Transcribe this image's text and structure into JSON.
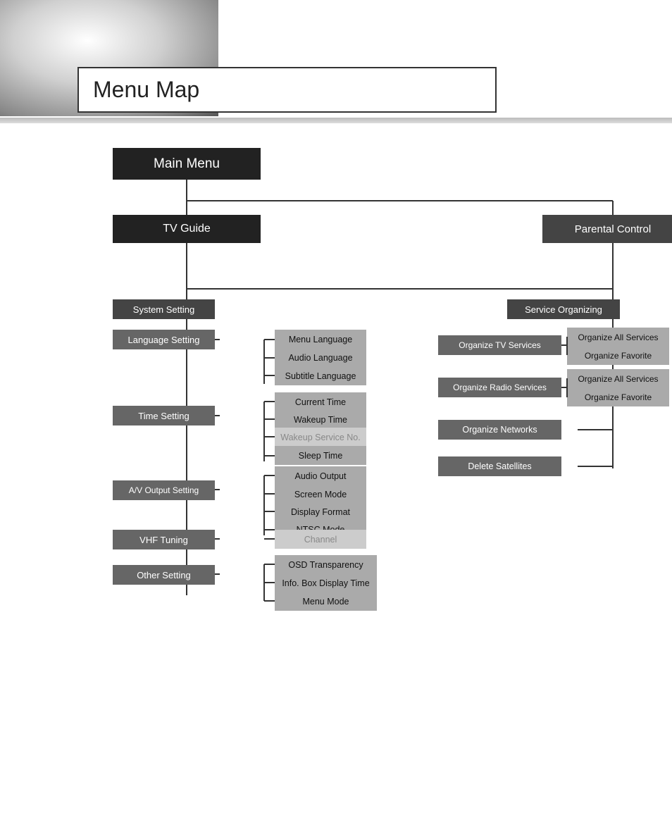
{
  "page": {
    "title": "Menu Map"
  },
  "main_menu": {
    "label": "Main Menu"
  },
  "level1": {
    "tvguide": "TV Guide",
    "parental": "Parental Control"
  },
  "left_tree": {
    "system_setting": "System Setting",
    "language_setting": {
      "label": "Language Setting",
      "children": [
        "Menu Language",
        "Audio Language",
        "Subtitle Language"
      ]
    },
    "time_setting": {
      "label": "Time Setting",
      "children": [
        "Current Time",
        "Wakeup Time",
        "Wakeup Service No.",
        "Sleep Time"
      ]
    },
    "av_output": {
      "label": "A/V Output Setting",
      "children": [
        "Audio Output",
        "Screen Mode",
        "Display Format",
        "NTSC Mode"
      ]
    },
    "vhf_tuning": {
      "label": "VHF Tuning",
      "children": [
        "Channel"
      ]
    },
    "other_setting": {
      "label": "Other Setting",
      "children": [
        "OSD Transparency",
        "Info. Box Display Time",
        "Menu Mode"
      ]
    }
  },
  "right_tree": {
    "service_organizing": "Service Organizing",
    "organize_tv": {
      "label": "Organize TV Services",
      "children": [
        "Organize All Services",
        "Organize Favorite"
      ]
    },
    "organize_radio": {
      "label": "Organize Radio Services",
      "children": [
        "Organize All Services",
        "Organize Favorite"
      ]
    },
    "organize_networks": "Organize Networks",
    "delete_satellites": "Delete Satellites"
  }
}
